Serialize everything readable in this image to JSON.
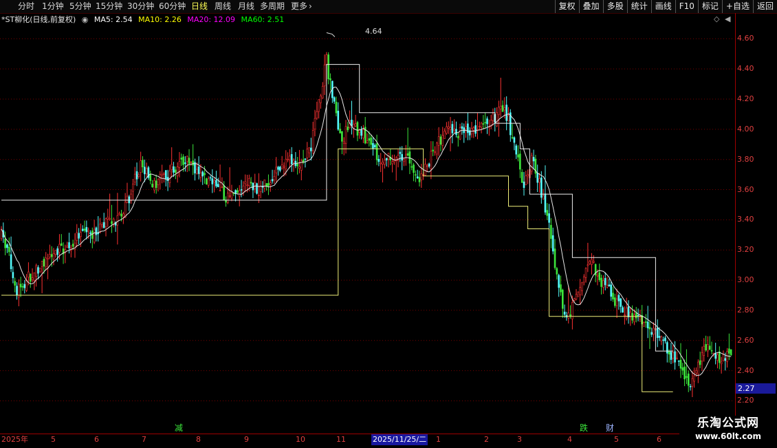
{
  "timeframes": [
    {
      "label": "分时",
      "active": false
    },
    {
      "label": "1分钟",
      "active": false
    },
    {
      "label": "5分钟",
      "active": false
    },
    {
      "label": "15分钟",
      "active": false
    },
    {
      "label": "30分钟",
      "active": false
    },
    {
      "label": "60分钟",
      "active": false
    },
    {
      "label": "日线",
      "active": true
    },
    {
      "label": "周线",
      "active": false
    },
    {
      "label": "月线",
      "active": false
    },
    {
      "label": "多周期",
      "active": false
    },
    {
      "label": "更多",
      "active": false
    }
  ],
  "toolbar": [
    "复权",
    "叠加",
    "多股",
    "统计",
    "画线",
    "F10",
    "标记",
    "+自选",
    "返回"
  ],
  "legend": {
    "title": "*ST柳化(日线,前复权)",
    "ma5": "MA5: 2.54",
    "ma10": "MA10: 2.26",
    "ma20": "MA20: 12.09",
    "ma60": "MA60: 2.51"
  },
  "colors": {
    "up": "#ff3232",
    "down": "#54fcfc",
    "green": "#3ce63c",
    "ma_white": "#e8e8e8",
    "step_white": "#f0f0f0",
    "step_yellow": "#f0f07a",
    "axis": "#e04040",
    "ma5": "#ffffff",
    "ma10": "#ffff00",
    "ma20": "#ff00ff",
    "ma60": "#00ff00"
  },
  "price_axis": [
    "4.60",
    "4.40",
    "4.20",
    "4.00",
    "3.80",
    "3.60",
    "3.40",
    "3.20",
    "3.00",
    "2.80",
    "2.60",
    "2.40",
    "2.20"
  ],
  "current_price": "2.27",
  "high_annotation": "4.64",
  "date_axis": [
    "2025年",
    "5",
    "6",
    "7",
    "8",
    "9",
    "10",
    "11",
    "1",
    "2",
    "3",
    "4",
    "5",
    "6"
  ],
  "date_cursor": "2025/11/25/二",
  "markers": [
    {
      "text": "减",
      "color": "#3ce63c"
    },
    {
      "text": "跌",
      "color": "#3ce63c"
    },
    {
      "text": "财",
      "color": "#9db4ff"
    }
  ],
  "watermark": {
    "title": "乐淘公式网",
    "url": "www.60lt.com"
  },
  "chart_data": {
    "type": "candlestick",
    "ylim": [
      2.12,
      4.72
    ],
    "y_ticks": [
      4.6,
      4.4,
      4.2,
      4.0,
      3.8,
      3.6,
      3.4,
      3.2,
      3.0,
      2.8,
      2.6,
      2.4,
      2.2
    ],
    "series": [
      {
        "name": "MA5",
        "value": 2.54
      },
      {
        "name": "MA10",
        "value": 2.26
      },
      {
        "name": "MA20",
        "value": 12.09
      },
      {
        "name": "MA60",
        "value": 2.51
      }
    ],
    "high": 4.64,
    "last": 2.27,
    "trend_anchors": [
      [
        0,
        3.3
      ],
      [
        4,
        3.15
      ],
      [
        8,
        2.92
      ],
      [
        14,
        3.02
      ],
      [
        22,
        3.1
      ],
      [
        30,
        3.2
      ],
      [
        38,
        3.27
      ],
      [
        46,
        3.3
      ],
      [
        54,
        3.38
      ],
      [
        62,
        3.42
      ],
      [
        68,
        3.62
      ],
      [
        72,
        3.78
      ],
      [
        78,
        3.62
      ],
      [
        86,
        3.7
      ],
      [
        94,
        3.8
      ],
      [
        102,
        3.72
      ],
      [
        110,
        3.62
      ],
      [
        116,
        3.56
      ],
      [
        122,
        3.62
      ],
      [
        128,
        3.65
      ],
      [
        134,
        3.6
      ],
      [
        140,
        3.7
      ],
      [
        148,
        3.78
      ],
      [
        156,
        3.8
      ],
      [
        160,
        3.9
      ],
      [
        164,
        4.2
      ],
      [
        168,
        4.45
      ],
      [
        172,
        4.15
      ],
      [
        176,
        3.92
      ],
      [
        180,
        4.05
      ],
      [
        186,
        3.98
      ],
      [
        192,
        3.86
      ],
      [
        198,
        3.8
      ],
      [
        204,
        3.82
      ],
      [
        210,
        3.8
      ],
      [
        216,
        3.68
      ],
      [
        222,
        3.82
      ],
      [
        230,
        4.0
      ],
      [
        238,
        3.98
      ],
      [
        246,
        4.0
      ],
      [
        252,
        4.02
      ],
      [
        258,
        4.15
      ],
      [
        262,
        4.05
      ],
      [
        266,
        3.85
      ],
      [
        270,
        3.6
      ],
      [
        274,
        3.8
      ],
      [
        280,
        3.55
      ],
      [
        284,
        3.3
      ],
      [
        288,
        2.95
      ],
      [
        292,
        2.75
      ],
      [
        298,
        2.9
      ],
      [
        304,
        3.15
      ],
      [
        310,
        3.0
      ],
      [
        316,
        2.88
      ],
      [
        322,
        2.8
      ],
      [
        330,
        2.75
      ],
      [
        338,
        2.66
      ],
      [
        346,
        2.5
      ],
      [
        352,
        2.38
      ],
      [
        356,
        2.28
      ],
      [
        360,
        2.42
      ],
      [
        364,
        2.55
      ],
      [
        370,
        2.48
      ],
      [
        376,
        2.52
      ]
    ],
    "step_white": [
      [
        0,
        3.53
      ],
      [
        168,
        3.53
      ],
      [
        168,
        4.43
      ],
      [
        185,
        4.43
      ],
      [
        185,
        4.11
      ],
      [
        255,
        4.11
      ],
      [
        255,
        4.04
      ],
      [
        268,
        4.04
      ],
      [
        268,
        3.87
      ],
      [
        273,
        3.87
      ],
      [
        273,
        3.57
      ],
      [
        295,
        3.57
      ],
      [
        295,
        3.15
      ],
      [
        338,
        3.15
      ],
      [
        338,
        2.53
      ],
      [
        347,
        2.53
      ]
    ],
    "step_yellow": [
      [
        0,
        2.9
      ],
      [
        174,
        2.9
      ],
      [
        174,
        3.87
      ],
      [
        218,
        3.87
      ],
      [
        218,
        3.69
      ],
      [
        262,
        3.69
      ],
      [
        262,
        3.49
      ],
      [
        272,
        3.49
      ],
      [
        272,
        3.34
      ],
      [
        283,
        3.34
      ],
      [
        283,
        2.76
      ],
      [
        331,
        2.76
      ],
      [
        331,
        2.26
      ],
      [
        347,
        2.26
      ]
    ]
  }
}
